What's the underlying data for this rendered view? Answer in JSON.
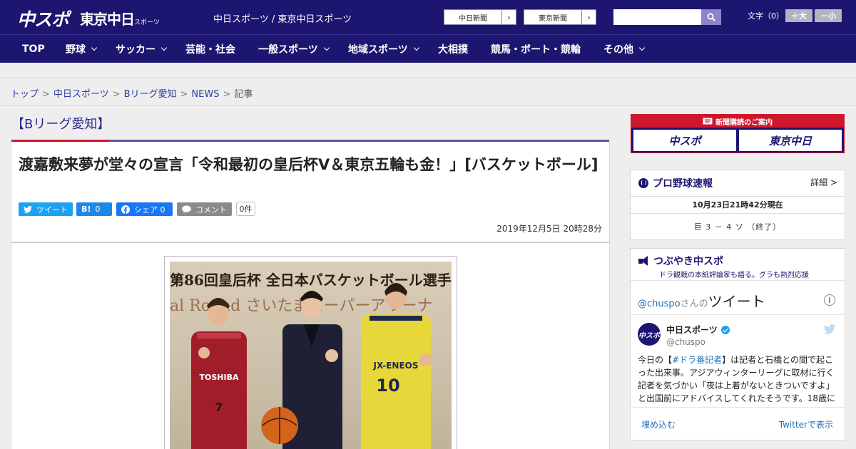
{
  "header": {
    "logo_chuspo": "中スポ",
    "logo_tokyo": "東京中日",
    "logo_tokyo_small": "スポーツ",
    "tagline": "中日スポーツ / 東京中日スポーツ",
    "links": [
      {
        "label": "中日新聞",
        "arrow": "›"
      },
      {
        "label": "東京新聞",
        "arrow": "›"
      }
    ],
    "search_placeholder": "",
    "font_size_label": "文字（0）",
    "font_bigger": "＋大",
    "font_smaller": "－小"
  },
  "nav": {
    "items": [
      {
        "label": "TOP",
        "dropdown": false
      },
      {
        "label": "野球",
        "dropdown": true
      },
      {
        "label": "サッカー",
        "dropdown": true
      },
      {
        "label": "芸能・社会",
        "dropdown": false
      },
      {
        "label": "一般スポーツ",
        "dropdown": true
      },
      {
        "label": "地域スポーツ",
        "dropdown": true
      },
      {
        "label": "大相撲",
        "dropdown": false
      },
      {
        "label": "競馬・ボート・競輪",
        "dropdown": false
      },
      {
        "label": "その他",
        "dropdown": true
      }
    ]
  },
  "breadcrumb": {
    "items": [
      "トップ",
      "中日スポーツ",
      "Bリーグ愛知",
      "NEWS"
    ],
    "current": "記事",
    "separator": ">"
  },
  "category": {
    "heading": "【Bリーグ愛知】"
  },
  "article": {
    "title": "渡嘉敷来夢が堂々の宣言「令和最初の皇后杯V＆東京五輪も金！」[バスケットボール]",
    "share": {
      "tweet": "ツイート",
      "hatena_icon": "B!",
      "hatena_count": "0",
      "facebook": "シェア 0",
      "comment": "コメント",
      "comment_count": "0件"
    },
    "date": "2019年12月5日 20時28分",
    "photo_banner_line1": "第86回皇后杯 全日本バスケットボール選手",
    "photo_banner_line2": "al  Round  さいたまスーパーアリーナ"
  },
  "sidebar": {
    "subscription": {
      "head": "新聞購読のご案内",
      "logo1": "中スポ",
      "logo2": "東京中日"
    },
    "baseball": {
      "title": "プロ野球速報",
      "more": "詳細 >",
      "time": "10月23日21時42分現在",
      "score": "巨 3 － 4 ソ （終了）"
    },
    "tweets": {
      "title": "つぶやき中スポ",
      "subtitle": "ドラ観戦の本紙評論家も語る。グラも熱烈応援",
      "handle_link": "@chuspo",
      "handle_suffix": "さんの",
      "heading": "ツイート",
      "info": "i",
      "account_name": "中日スポーツ",
      "account_handle": "@chuspo",
      "avatar_text": "中スポ",
      "body_prefix": "今日の【",
      "body_tag": "#ドラ番記者",
      "body_rest": "】は記者と石橋との間で起こった出来事。アジアウィンターリーグに取材に行く記者を気づかい「夜は上着がないときついですよ」と出国前にアドバイスしてくれたそうです。18歳に",
      "embed": "埋め込む",
      "view_on_twitter": "Twitterで表示"
    }
  },
  "colors": {
    "navy": "#1c1670",
    "red": "#d0162c",
    "twitter": "#1da1f2",
    "hatena": "#1e88e5",
    "facebook": "#1877f2",
    "comment": "#8a8a8a"
  }
}
